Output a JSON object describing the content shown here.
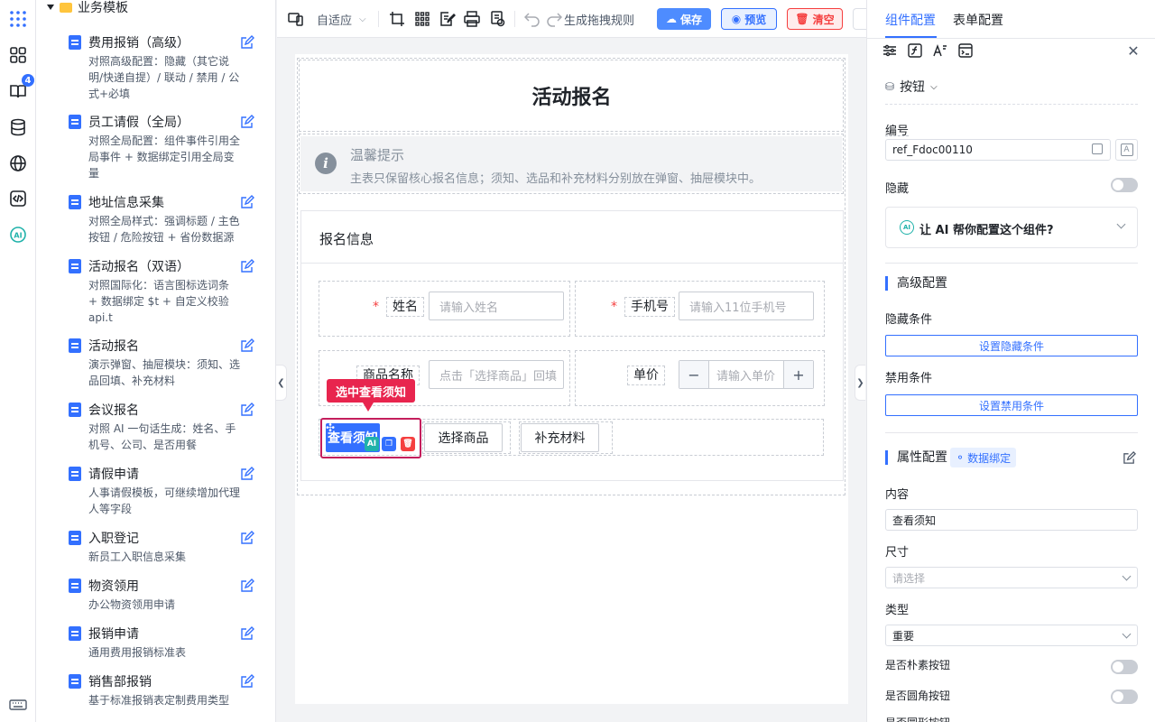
{
  "rail": {
    "items": [
      "apps-grid-icon",
      "components-icon",
      "book-icon",
      "database-icon",
      "globe-icon",
      "code-icon",
      "ai-icon",
      "keyboard-icon"
    ],
    "badge": "4",
    "ai_label": "AI"
  },
  "templates": {
    "group": "业务模板",
    "items": [
      {
        "title": "费用报销（高级）",
        "desc": "对照高级配置：隐藏（其它说明/快递自提）/ 联动 / 禁用 / 公式+必填"
      },
      {
        "title": "员工请假（全局）",
        "desc": "对照全局配置：组件事件引用全局事件 + 数据绑定引用全局变量"
      },
      {
        "title": "地址信息采集",
        "desc": "对照全局样式：强调标题 / 主色按钮 / 危险按钮 + 省份数据源"
      },
      {
        "title": "活动报名（双语）",
        "desc": "对照国际化：语言图标选词条 + 数据绑定 $t + 自定义校验 api.t"
      },
      {
        "title": "活动报名",
        "desc": "演示弹窗、抽屉模块：须知、选品回填、补充材料"
      },
      {
        "title": "会议报名",
        "desc": "对照 AI 一句话生成：姓名、手机号、公司、是否用餐"
      },
      {
        "title": "请假申请",
        "desc": "人事请假模板，可继续增加代理人等字段"
      },
      {
        "title": "入职登记",
        "desc": "新员工入职信息采集"
      },
      {
        "title": "物资领用",
        "desc": "办公物资领用申请"
      },
      {
        "title": "报销申请",
        "desc": "通用费用报销标准表"
      },
      {
        "title": "销售部报销",
        "desc": "基于标准报销表定制费用类型"
      }
    ]
  },
  "toolbar": {
    "layout_mode": "自适应",
    "generate_rules": "生成拖拽规则",
    "save": "保存",
    "preview": "预览",
    "clear": "清空"
  },
  "form": {
    "title": "活动报名",
    "alert_title": "温馨提示",
    "alert_desc": "主表只保留核心报名信息；须知、选品和补充材料分别放在弹窗、抽屉模块中。",
    "card_title": "报名信息",
    "name_label": "姓名",
    "name_placeholder": "请输入姓名",
    "phone_label": "手机号",
    "phone_placeholder": "请输入11位手机号",
    "product_label": "商品名称",
    "product_placeholder": "点击「选择商品」回填",
    "price_label": "单价",
    "price_placeholder": "请输入单价",
    "btn_notice": "查看须知",
    "btn_select": "选择商品",
    "btn_material": "补充材料",
    "selected_tip": "选中查看须知",
    "mini_ai": "AI"
  },
  "right_panel": {
    "tab_component": "组件配置",
    "tab_form": "表单配置",
    "component_type": "按钮",
    "id_label": "编号",
    "id_value": "ref_Fdoc00110",
    "id_badge": "A",
    "hidden_label": "隐藏",
    "ai_prompt": "让 AI 帮你配置这个组件?",
    "ai_badge": "AI",
    "advanced_title": "高级配置",
    "hide_cond_label": "隐藏条件",
    "hide_cond_btn": "设置隐藏条件",
    "disable_cond_label": "禁用条件",
    "disable_cond_btn": "设置禁用条件",
    "prop_title": "属性配置",
    "data_binding": "数据绑定",
    "content_label": "内容",
    "content_value": "查看须知",
    "size_label": "尺寸",
    "size_placeholder": "请选择",
    "type_label": "类型",
    "type_value": "重要",
    "plain_label": "是否朴素按钮",
    "round_label": "是否圆角按钮",
    "circle_label": "是否圆形按钮"
  }
}
